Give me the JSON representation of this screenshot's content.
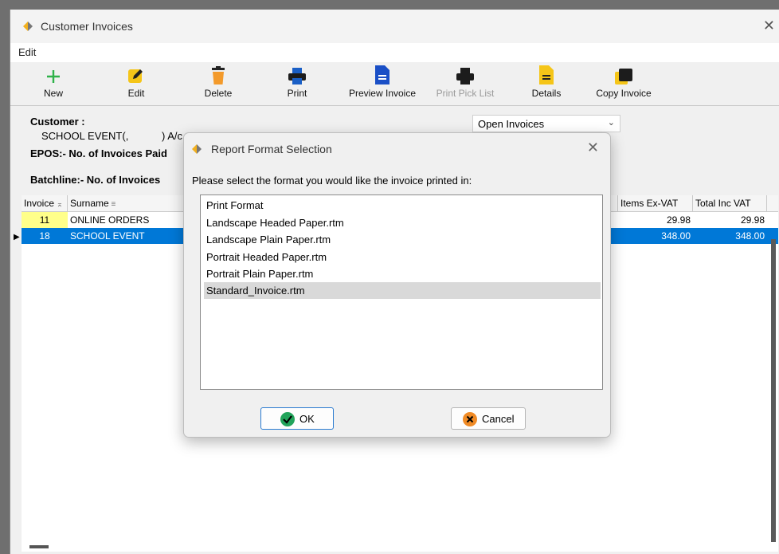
{
  "window": {
    "title": "Customer Invoices",
    "close_glyph": "✕"
  },
  "menu": {
    "edit": "Edit"
  },
  "toolbar": [
    {
      "label": "New",
      "icon": "plus-icon",
      "enabled": true
    },
    {
      "label": "Edit",
      "icon": "pencil-icon",
      "enabled": true
    },
    {
      "label": "Delete",
      "icon": "trash-icon",
      "enabled": true
    },
    {
      "label": "Print",
      "icon": "printer-icon",
      "enabled": true
    },
    {
      "label": "Preview Invoice",
      "icon": "document-icon",
      "enabled": true
    },
    {
      "label": "Print Pick List",
      "icon": "printer-icon",
      "enabled": false
    },
    {
      "label": "Details",
      "icon": "details-icon",
      "enabled": true
    },
    {
      "label": "Copy Invoice",
      "icon": "copy-icon",
      "enabled": true
    }
  ],
  "customer": {
    "label": "Customer :",
    "name": "SCHOOL EVENT(,",
    "ac": ") A/c",
    "epos": "EPOS:- No. of Invoices Paid",
    "batchline": "Batchline:- No. of Invoices"
  },
  "filter": {
    "selected": "Open Invoices"
  },
  "grid": {
    "headers": {
      "invoice": "Invoice",
      "surname": "Surname",
      "items_ex_vat": "Items Ex-VAT",
      "total_inc_vat": "Total Inc VAT"
    },
    "rows": [
      {
        "invoice": "11",
        "surname": "ONLINE ORDERS",
        "items_ex_vat": "29.98",
        "total_inc_vat": "29.98",
        "selected": false
      },
      {
        "invoice": "18",
        "surname": "SCHOOL EVENT",
        "items_ex_vat": "348.00",
        "total_inc_vat": "348.00",
        "selected": true
      }
    ]
  },
  "dialog": {
    "title": "Report Format Selection",
    "prompt": "Please select the format you would like the invoice printed in:",
    "options": [
      "Print Format",
      "Landscape Headed Paper.rtm",
      "Landscape Plain Paper.rtm",
      "Portrait Headed Paper.rtm",
      "Portrait Plain Paper.rtm",
      "Standard_Invoice.rtm"
    ],
    "selected_index": 5,
    "ok": "OK",
    "cancel": "Cancel"
  },
  "colors": {
    "selection": "#0078d7",
    "highlight_cell": "#ffff8a",
    "ok_icon": "#21a35a",
    "cancel_icon": "#f08a24"
  }
}
